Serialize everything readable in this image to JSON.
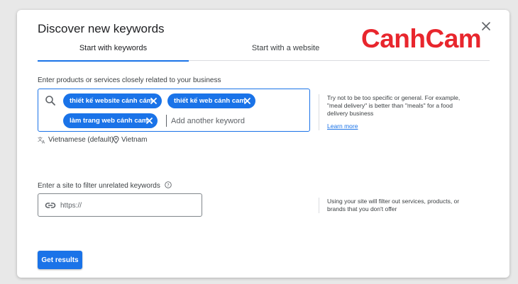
{
  "dialog": {
    "title": "Discover new keywords",
    "close_icon": "close-icon"
  },
  "logo": {
    "text": "CanhCam",
    "color": "#e8262d"
  },
  "tabs": [
    {
      "label": "Start with keywords",
      "active": true
    },
    {
      "label": "Start with a website",
      "active": false
    }
  ],
  "keywords_section": {
    "label": "Enter products or services closely related to your business",
    "chips": [
      {
        "label": "thiết kế website cánh cám"
      },
      {
        "label": "thiết kế web cánh cam"
      },
      {
        "label": "làm trang web cánh cam"
      }
    ],
    "input_placeholder": "Add another keyword",
    "language": "Vietnamese (default)",
    "location": "Vietnam",
    "hint": "Try not to be too specific or general. For example, \"meal delivery\" is better than \"meals\" for a food delivery business",
    "learn_more": "Learn more"
  },
  "site_section": {
    "label": "Enter a site to filter unrelated keywords",
    "input_placeholder": "https://",
    "hint": "Using your site will filter out services, products, or brands that you don't offer"
  },
  "actions": {
    "get_results": "Get results"
  },
  "colors": {
    "accent": "#1a73e8",
    "brand": "#e8262d"
  }
}
